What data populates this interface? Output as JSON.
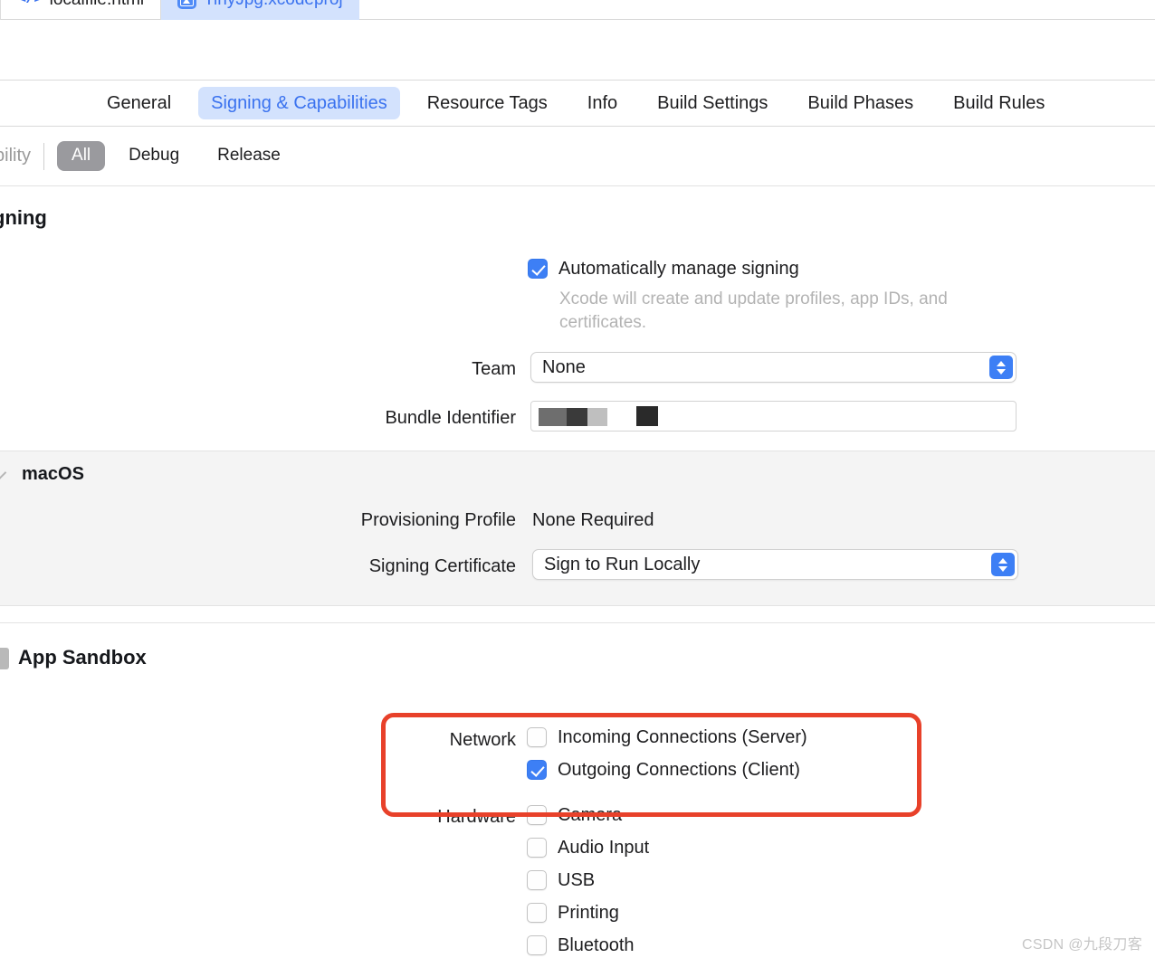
{
  "editor_tabs": [
    {
      "label": "localfile.html",
      "icon": "code-icon",
      "active": false
    },
    {
      "label": "TinyJpg.xcodeproj",
      "icon": "appstore-icon",
      "active": true
    }
  ],
  "project_tabs": [
    {
      "label": "General",
      "selected": false
    },
    {
      "label": "Signing & Capabilities",
      "selected": true
    },
    {
      "label": "Resource Tags",
      "selected": false
    },
    {
      "label": "Info",
      "selected": false
    },
    {
      "label": "Build Settings",
      "selected": false
    },
    {
      "label": "Build Phases",
      "selected": false
    },
    {
      "label": "Build Rules",
      "selected": false
    }
  ],
  "config_bar": {
    "clipped_label": "bility",
    "segments": [
      {
        "label": "All",
        "selected": true
      },
      {
        "label": "Debug",
        "selected": false
      },
      {
        "label": "Release",
        "selected": false
      }
    ]
  },
  "signing": {
    "section_title_clipped": "gning",
    "auto_manage": {
      "label": "Automatically manage signing",
      "checked": true,
      "description": "Xcode will create and update profiles, app IDs, and certificates."
    },
    "team": {
      "label": "Team",
      "value": "None"
    },
    "bundle_identifier": {
      "label": "Bundle Identifier",
      "value": ""
    }
  },
  "platform": {
    "name": "macOS",
    "provisioning_profile": {
      "label": "Provisioning Profile",
      "value": "None Required"
    },
    "signing_certificate": {
      "label": "Signing Certificate",
      "value": "Sign to Run Locally"
    }
  },
  "app_sandbox": {
    "title": "App Sandbox",
    "groups": [
      {
        "label": "Network",
        "items": [
          {
            "label": "Incoming Connections (Server)",
            "checked": false
          },
          {
            "label": "Outgoing Connections (Client)",
            "checked": true
          }
        ]
      },
      {
        "label": "Hardware",
        "items": [
          {
            "label": "Camera",
            "checked": false
          },
          {
            "label": "Audio Input",
            "checked": false
          },
          {
            "label": "USB",
            "checked": false
          },
          {
            "label": "Printing",
            "checked": false
          },
          {
            "label": "Bluetooth",
            "checked": false
          }
        ]
      }
    ]
  },
  "annotation": {
    "color": "#e8412a"
  },
  "watermark": "CSDN @九段刀客"
}
